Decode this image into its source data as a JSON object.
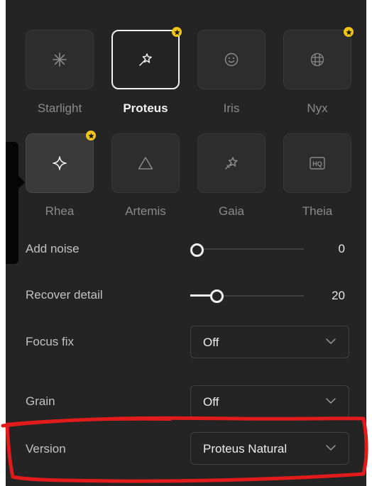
{
  "models": [
    {
      "label": "Starlight",
      "icon": "asterisk-icon",
      "selected": false,
      "premium": false
    },
    {
      "label": "Proteus",
      "icon": "magic-wand-icon",
      "selected": true,
      "premium": true
    },
    {
      "label": "Iris",
      "icon": "smiley-face-icon",
      "selected": false,
      "premium": false
    },
    {
      "label": "Nyx",
      "icon": "grid-globe-icon",
      "selected": false,
      "premium": true
    },
    {
      "label": "Rhea",
      "icon": "sparkle-icon",
      "selected": false,
      "premium": true
    },
    {
      "label": "Artemis",
      "icon": "triangle-icon",
      "selected": false,
      "premium": false
    },
    {
      "label": "Gaia",
      "icon": "magic-wand-icon",
      "selected": false,
      "premium": false
    },
    {
      "label": "Theia",
      "icon": "hq-icon",
      "selected": false,
      "premium": false
    }
  ],
  "settings": {
    "add_noise": {
      "label": "Add noise",
      "value": "0",
      "level": 0.0
    },
    "recover_detail": {
      "label": "Recover detail",
      "value": "20",
      "level": 0.2
    },
    "focus_fix": {
      "label": "Focus fix",
      "value": "Off"
    },
    "grain": {
      "label": "Grain",
      "value": "Off"
    },
    "version": {
      "label": "Version",
      "value": "Proteus Natural"
    }
  },
  "colors": {
    "panel_bg": "#242424",
    "premium_badge": "#f2c618",
    "annotation": "#e11b1b"
  }
}
